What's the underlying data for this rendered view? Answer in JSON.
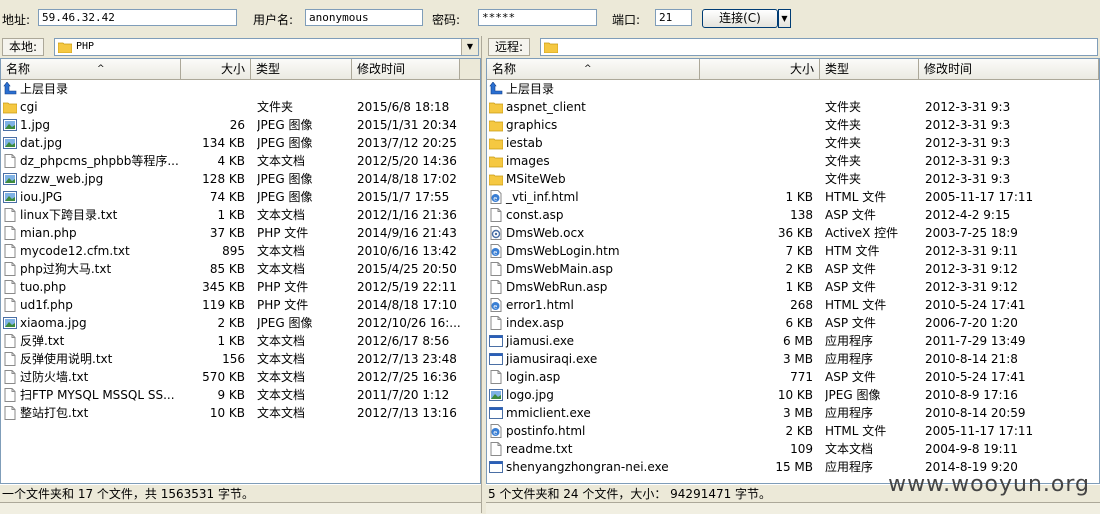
{
  "connection": {
    "address_label": "地址:",
    "address_value": "59.46.32.42",
    "user_label": "用户名:",
    "user_value": "anonymous",
    "password_label": "密码:",
    "password_value": "*****",
    "port_label": "端口:",
    "port_value": "21",
    "connect_label": "连接(C)"
  },
  "columns": {
    "name": "名称",
    "size": "大小",
    "type": "类型",
    "modified": "修改时间"
  },
  "local": {
    "label": "本地:",
    "path": "PHP",
    "up_label": "上层目录",
    "files": [
      {
        "name": "cgi",
        "size": "",
        "type": "文件夹",
        "modified": "2015/6/8 18:18",
        "icon": "folder"
      },
      {
        "name": "1.jpg",
        "size": "26",
        "type": "JPEG 图像",
        "modified": "2015/1/31 20:34",
        "icon": "image"
      },
      {
        "name": "dat.jpg",
        "size": "134 KB",
        "type": "JPEG 图像",
        "modified": "2013/7/12 20:25",
        "icon": "image"
      },
      {
        "name": "dz_phpcms_phpbb等程序...",
        "size": "4 KB",
        "type": "文本文档",
        "modified": "2012/5/20 14:36",
        "icon": "text"
      },
      {
        "name": "dzzw_web.jpg",
        "size": "128 KB",
        "type": "JPEG 图像",
        "modified": "2014/8/18 17:02",
        "icon": "image"
      },
      {
        "name": "iou.JPG",
        "size": "74 KB",
        "type": "JPEG 图像",
        "modified": "2015/1/7 17:55",
        "icon": "image"
      },
      {
        "name": "linux下跨目录.txt",
        "size": "1 KB",
        "type": "文本文档",
        "modified": "2012/1/16 21:36",
        "icon": "text"
      },
      {
        "name": "mian.php",
        "size": "37 KB",
        "type": "PHP 文件",
        "modified": "2014/9/16 21:43",
        "icon": "text"
      },
      {
        "name": "mycode12.cfm.txt",
        "size": "895",
        "type": "文本文档",
        "modified": "2010/6/16 13:42",
        "icon": "text"
      },
      {
        "name": "php过狗大马.txt",
        "size": "85 KB",
        "type": "文本文档",
        "modified": "2015/4/25 20:50",
        "icon": "text"
      },
      {
        "name": "tuo.php",
        "size": "345 KB",
        "type": "PHP 文件",
        "modified": "2012/5/19 22:11",
        "icon": "text"
      },
      {
        "name": "ud1f.php",
        "size": "119 KB",
        "type": "PHP 文件",
        "modified": "2014/8/18 17:10",
        "icon": "text"
      },
      {
        "name": "xiaoma.jpg",
        "size": "2 KB",
        "type": "JPEG 图像",
        "modified": "2012/10/26 16:...",
        "icon": "image"
      },
      {
        "name": "反弹.txt",
        "size": "1 KB",
        "type": "文本文档",
        "modified": "2012/6/17 8:56",
        "icon": "text"
      },
      {
        "name": "反弹使用说明.txt",
        "size": "156",
        "type": "文本文档",
        "modified": "2012/7/13 23:48",
        "icon": "text"
      },
      {
        "name": "过防火墙.txt",
        "size": "570 KB",
        "type": "文本文档",
        "modified": "2012/7/25 16:36",
        "icon": "text"
      },
      {
        "name": "扫FTP MYSQL MSSQL SS...",
        "size": "9 KB",
        "type": "文本文档",
        "modified": "2011/7/20 1:12",
        "icon": "text"
      },
      {
        "name": "整站打包.txt",
        "size": "10 KB",
        "type": "文本文档",
        "modified": "2012/7/13 13:16",
        "icon": "text"
      }
    ],
    "status": "一个文件夹和 17 个文件，共 1563531 字节。"
  },
  "remote": {
    "label": "远程:",
    "path": "",
    "up_label": "上层目录",
    "files": [
      {
        "name": "aspnet_client",
        "size": "",
        "type": "文件夹",
        "modified": "2012-3-31 9:3",
        "icon": "folder"
      },
      {
        "name": "graphics",
        "size": "",
        "type": "文件夹",
        "modified": "2012-3-31 9:3",
        "icon": "folder"
      },
      {
        "name": "iestab",
        "size": "",
        "type": "文件夹",
        "modified": "2012-3-31 9:3",
        "icon": "folder"
      },
      {
        "name": "images",
        "size": "",
        "type": "文件夹",
        "modified": "2012-3-31 9:3",
        "icon": "folder"
      },
      {
        "name": "MSiteWeb",
        "size": "",
        "type": "文件夹",
        "modified": "2012-3-31 9:3",
        "icon": "folder"
      },
      {
        "name": "_vti_inf.html",
        "size": "1 KB",
        "type": "HTML 文件",
        "modified": "2005-11-17 17:11",
        "icon": "html"
      },
      {
        "name": "const.asp",
        "size": "138",
        "type": "ASP 文件",
        "modified": "2012-4-2 9:15",
        "icon": "text"
      },
      {
        "name": "DmsWeb.ocx",
        "size": "36 KB",
        "type": "ActiveX 控件",
        "modified": "2003-7-25 18:9",
        "icon": "ocx"
      },
      {
        "name": "DmsWebLogin.htm",
        "size": "7 KB",
        "type": "HTM 文件",
        "modified": "2012-3-31 9:11",
        "icon": "html"
      },
      {
        "name": "DmsWebMain.asp",
        "size": "2 KB",
        "type": "ASP 文件",
        "modified": "2012-3-31 9:12",
        "icon": "text"
      },
      {
        "name": "DmsWebRun.asp",
        "size": "1 KB",
        "type": "ASP 文件",
        "modified": "2012-3-31 9:12",
        "icon": "text"
      },
      {
        "name": "error1.html",
        "size": "268",
        "type": "HTML 文件",
        "modified": "2010-5-24 17:41",
        "icon": "html"
      },
      {
        "name": "index.asp",
        "size": "6 KB",
        "type": "ASP 文件",
        "modified": "2006-7-20 1:20",
        "icon": "text"
      },
      {
        "name": "jiamusi.exe",
        "size": "6 MB",
        "type": "应用程序",
        "modified": "2011-7-29 13:49",
        "icon": "exe"
      },
      {
        "name": "jiamusiraqi.exe",
        "size": "3 MB",
        "type": "应用程序",
        "modified": "2010-8-14 21:8",
        "icon": "exe"
      },
      {
        "name": "login.asp",
        "size": "771",
        "type": "ASP 文件",
        "modified": "2010-5-24 17:41",
        "icon": "text"
      },
      {
        "name": "logo.jpg",
        "size": "10 KB",
        "type": "JPEG 图像",
        "modified": "2010-8-9 17:16",
        "icon": "image"
      },
      {
        "name": "mmiclient.exe",
        "size": "3 MB",
        "type": "应用程序",
        "modified": "2010-8-14 20:59",
        "icon": "exe"
      },
      {
        "name": "postinfo.html",
        "size": "2 KB",
        "type": "HTML 文件",
        "modified": "2005-11-17 17:11",
        "icon": "html"
      },
      {
        "name": "readme.txt",
        "size": "109",
        "type": "文本文档",
        "modified": "2004-9-8 19:11",
        "icon": "text"
      },
      {
        "name": "shenyangzhongran-nei.exe",
        "size": "15 MB",
        "type": "应用程序",
        "modified": "2014-8-19 9:20",
        "icon": "exe"
      }
    ],
    "status": "5 个文件夹和 24 个文件，大小： 94291471 字节。"
  },
  "watermark": "www.wooyun.org"
}
